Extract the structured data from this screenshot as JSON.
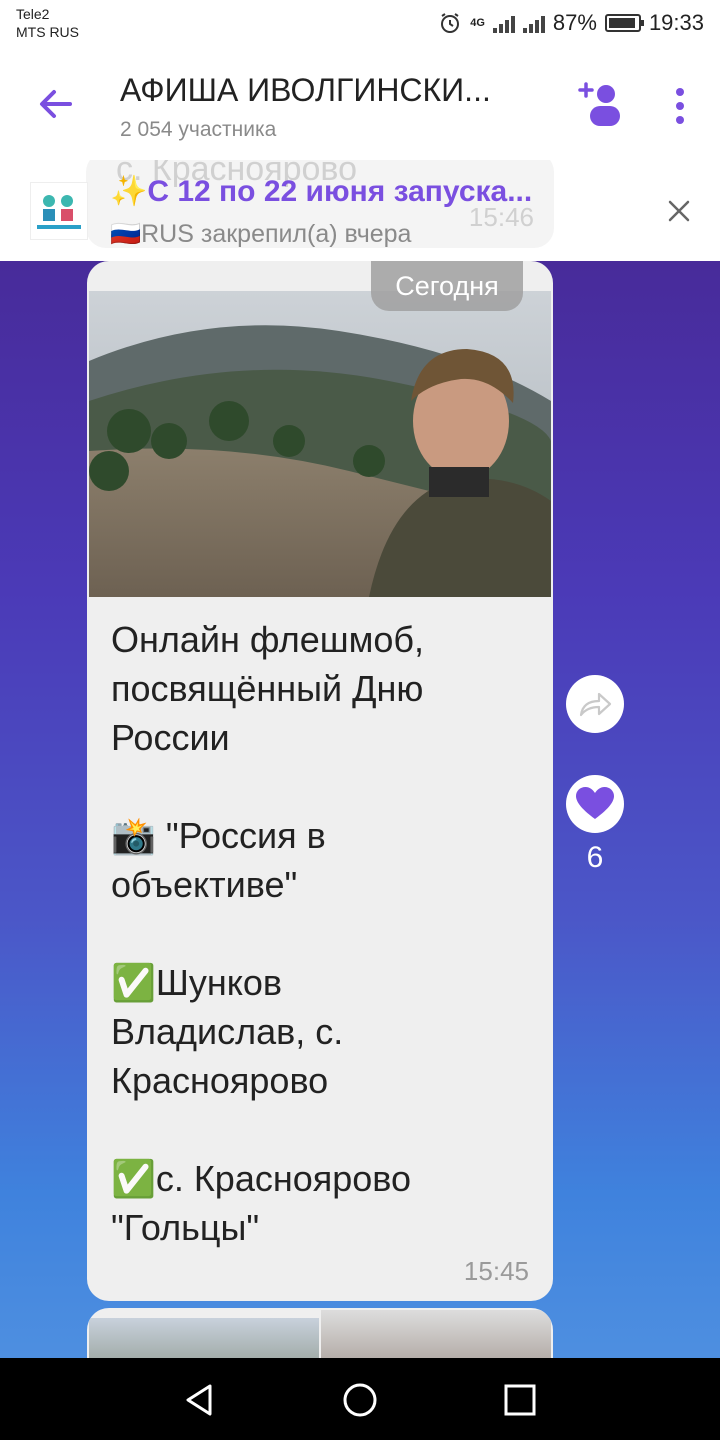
{
  "status_bar": {
    "carrier_line1": "Tele2",
    "carrier_line2": "MTS RUS",
    "battery": "87%",
    "time": "19:33",
    "network": "4G"
  },
  "header": {
    "title": "АФИША ИВОЛГИНСКИ...",
    "subtitle": "2 054 участника"
  },
  "pinned": {
    "text": "✨С 12 по 22 июня запуска...",
    "meta": "🇷🇺RUS закрепил(а) вчера",
    "ghost_text": "с. Красноярово",
    "ghost_time": "15:46"
  },
  "chat": {
    "date_divider": "Сегодня",
    "message": {
      "lines": [
        "Онлайн флешмоб,",
        "посвящённый Дню",
        "России",
        "",
        "📸 \"Россия в",
        "объективе\"",
        "",
        "✅Шунков",
        "Владислав, с.",
        "Красноярово",
        "",
        "✅с. Красноярово",
        "\"Гольцы\""
      ],
      "time": "15:45",
      "likes": "6"
    }
  },
  "colors": {
    "accent": "#7a4fe0",
    "like": "#7a4fe0"
  },
  "icons": [
    "back-arrow-icon",
    "add-user-icon",
    "more-icon",
    "close-icon",
    "share-icon",
    "heart-icon",
    "nav-back-icon",
    "nav-home-icon",
    "nav-recents-icon"
  ]
}
